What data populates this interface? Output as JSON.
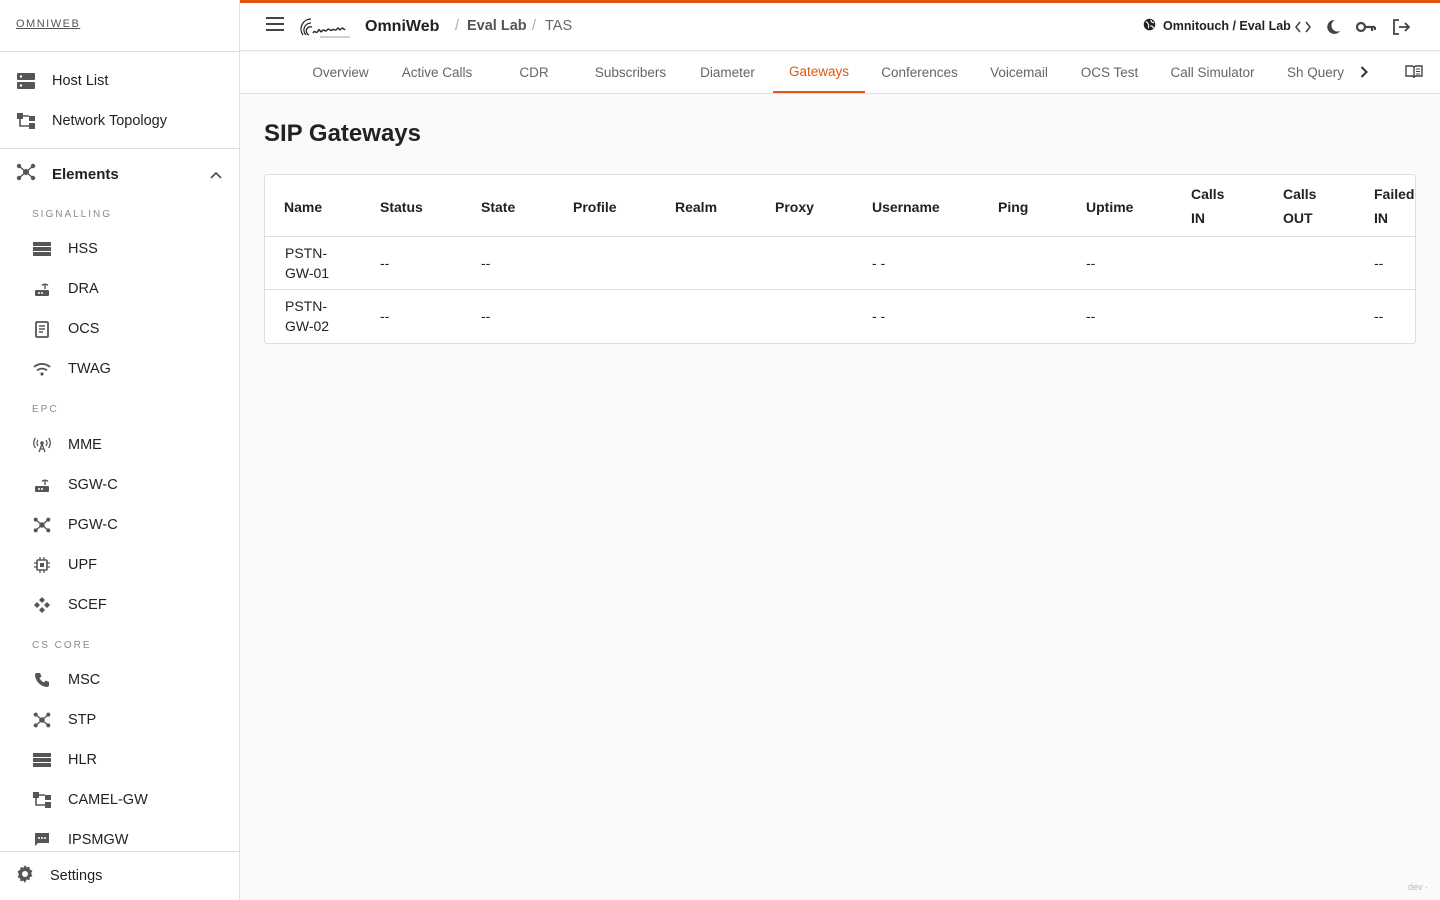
{
  "sidebar": {
    "brand": "OMNIWEB",
    "top_items": [
      {
        "label": "Host List",
        "icon": "host-list-icon"
      },
      {
        "label": "Network Topology",
        "icon": "topology-icon"
      }
    ],
    "elements_label": "Elements",
    "sections": [
      {
        "title": "SIGNALLING",
        "items": [
          {
            "label": "HSS",
            "icon": "storage-icon"
          },
          {
            "label": "DRA",
            "icon": "router-icon"
          },
          {
            "label": "OCS",
            "icon": "billing-icon"
          },
          {
            "label": "TWAG",
            "icon": "wifi-icon"
          }
        ]
      },
      {
        "title": "EPC",
        "items": [
          {
            "label": "MME",
            "icon": "antenna-icon"
          },
          {
            "label": "SGW-C",
            "icon": "router-icon"
          },
          {
            "label": "PGW-C",
            "icon": "hub-icon"
          },
          {
            "label": "UPF",
            "icon": "chip-icon"
          },
          {
            "label": "SCEF",
            "icon": "diamond-nodes-icon"
          }
        ]
      },
      {
        "title": "CS CORE",
        "items": [
          {
            "label": "MSC",
            "icon": "phone-icon"
          },
          {
            "label": "STP",
            "icon": "hub-icon"
          },
          {
            "label": "HLR",
            "icon": "storage-icon"
          },
          {
            "label": "CAMEL-GW",
            "icon": "topology-icon"
          },
          {
            "label": "IPSMGW",
            "icon": "message-icon"
          }
        ]
      }
    ],
    "settings_label": "Settings"
  },
  "header": {
    "app_name": "OmniWeb",
    "breadcrumb": [
      "Eval Lab",
      "TAS"
    ],
    "breadcrumb_sep": "/",
    "org_label": "Omnitouch / Eval Lab"
  },
  "tabs": {
    "items": [
      "Overview",
      "Active Calls",
      "CDR",
      "Subscribers",
      "Diameter",
      "Gateways",
      "Conferences",
      "Voicemail",
      "OCS Test",
      "Call Simulator",
      "Sh Query"
    ],
    "active": "Gateways"
  },
  "main": {
    "title": "SIP Gateways",
    "columns": [
      {
        "l1": "Name",
        "l2": ""
      },
      {
        "l1": "Status",
        "l2": ""
      },
      {
        "l1": "State",
        "l2": ""
      },
      {
        "l1": "Profile",
        "l2": ""
      },
      {
        "l1": "Realm",
        "l2": ""
      },
      {
        "l1": "Proxy",
        "l2": ""
      },
      {
        "l1": "Username",
        "l2": ""
      },
      {
        "l1": "Ping",
        "l2": ""
      },
      {
        "l1": "Uptime",
        "l2": ""
      },
      {
        "l1": "Calls",
        "l2": "IN"
      },
      {
        "l1": "Calls",
        "l2": "OUT"
      },
      {
        "l1": "Failed",
        "l2": "IN"
      }
    ],
    "rows": [
      {
        "name1": "PSTN-",
        "name2": "GW-01",
        "status": "--",
        "state": "--",
        "profile": "",
        "realm": "",
        "proxy": "",
        "username": "- -",
        "ping": "",
        "uptime": "--",
        "calls_in": "",
        "calls_out": "",
        "failed_in": "--"
      },
      {
        "name1": "PSTN-",
        "name2": "GW-02",
        "status": "--",
        "state": "--",
        "profile": "",
        "realm": "",
        "proxy": "",
        "username": "- -",
        "ping": "",
        "uptime": "--",
        "calls_in": "",
        "calls_out": "",
        "failed_in": "--"
      }
    ]
  },
  "footer": {
    "env": "dev ·"
  },
  "colors": {
    "accent": "#e0570f",
    "text": "#222222",
    "muted": "#666666"
  }
}
